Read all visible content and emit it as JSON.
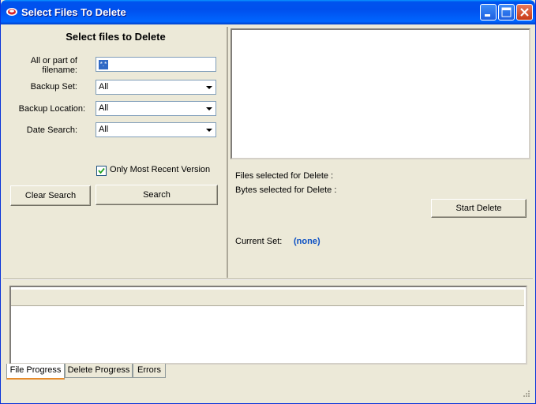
{
  "window": {
    "title": "Select Files To Delete"
  },
  "left": {
    "heading": "Select files to Delete",
    "filename_label": "All or part of filename:",
    "filename_value": "*.*",
    "backup_set_label": "Backup Set:",
    "backup_set_value": "All",
    "backup_location_label": "Backup Location:",
    "backup_location_value": "All",
    "date_search_label": "Date Search:",
    "date_search_value": "All",
    "recent_only_label": "Only Most Recent Version",
    "recent_only_checked": true,
    "clear_label": "Clear Search",
    "search_label": "Search"
  },
  "right": {
    "files_selected_label": "Files selected for Delete :",
    "bytes_selected_label": "Bytes selected for Delete :",
    "start_delete_label": "Start Delete",
    "current_set_label": "Current Set:",
    "current_set_value": "(none)"
  },
  "tabs": [
    "File Progress",
    "Delete Progress",
    "Errors"
  ],
  "colors": {
    "title_bar": "#0058ee",
    "accent_text": "#0a4fc4"
  }
}
